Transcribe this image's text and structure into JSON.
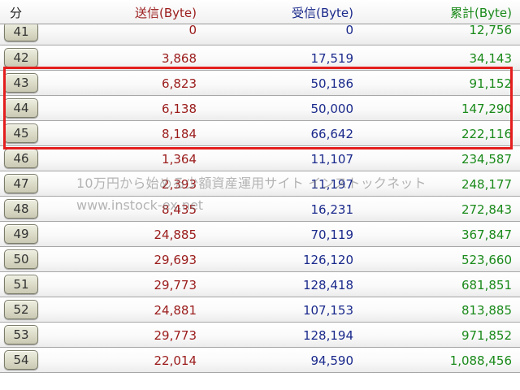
{
  "header": {
    "min_label": "分",
    "sent_label": "送信(Byte)",
    "recv_label": "受信(Byte)",
    "total_label": "累計(Byte)"
  },
  "colors": {
    "sent": "#9b1b1b",
    "recv": "#1b2a8c",
    "total": "#1a8a1a",
    "highlight": "#e41e1e"
  },
  "rows": [
    {
      "min": "41",
      "sent": "0",
      "recv": "0",
      "total": "12,756"
    },
    {
      "min": "42",
      "sent": "3,868",
      "recv": "17,519",
      "total": "34,143"
    },
    {
      "min": "43",
      "sent": "6,823",
      "recv": "50,186",
      "total": "91,152"
    },
    {
      "min": "44",
      "sent": "6,138",
      "recv": "50,000",
      "total": "147,290"
    },
    {
      "min": "45",
      "sent": "8,184",
      "recv": "66,642",
      "total": "222,116"
    },
    {
      "min": "46",
      "sent": "1,364",
      "recv": "11,107",
      "total": "234,587"
    },
    {
      "min": "47",
      "sent": "2,393",
      "recv": "11,197",
      "total": "248,177"
    },
    {
      "min": "48",
      "sent": "8,435",
      "recv": "16,231",
      "total": "272,843"
    },
    {
      "min": "49",
      "sent": "24,885",
      "recv": "70,119",
      "total": "367,847"
    },
    {
      "min": "50",
      "sent": "29,693",
      "recv": "126,120",
      "total": "523,660"
    },
    {
      "min": "51",
      "sent": "29,773",
      "recv": "128,418",
      "total": "681,851"
    },
    {
      "min": "52",
      "sent": "24,881",
      "recv": "107,153",
      "total": "813,885"
    },
    {
      "min": "53",
      "sent": "29,773",
      "recv": "128,194",
      "total": "971,852"
    },
    {
      "min": "54",
      "sent": "22,014",
      "recv": "94,590",
      "total": "1,088,456"
    }
  ],
  "watermark": {
    "line1": "10万円から始める少額資産運用サイト インストックネット",
    "line2": "www.instock-ex.net"
  }
}
